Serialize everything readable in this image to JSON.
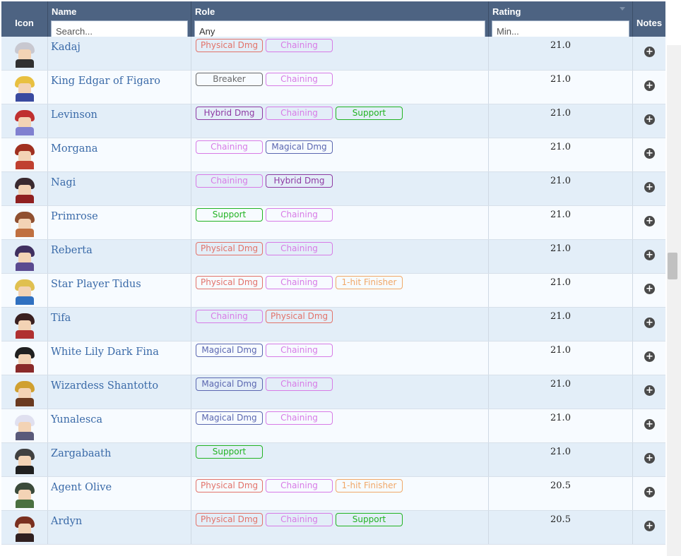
{
  "header": {
    "icon_label": "Icon",
    "name_label": "Name",
    "name_placeholder": "Search...",
    "role_label": "Role",
    "role_value": "Any",
    "rating_label": "Rating",
    "rating_placeholder": "Min...",
    "notes_label": "Notes"
  },
  "tag_colors": {
    "Physical Dmg": "#e2736a",
    "Chaining": "#d77be6",
    "Breaker": "#6a6a6a",
    "Hybrid Dmg": "#8e3aa3",
    "Support": "#22b322",
    "Magical Dmg": "#5b67b0",
    "1-hit Finisher": "#f0a868"
  },
  "rows": [
    {
      "name": "Kadaj",
      "roles": [
        "Physical Dmg",
        "Chaining"
      ],
      "rating": "21.0",
      "icon": "silver-haired-character-icon",
      "hair": "#c8c8d0",
      "outfit": "#303030"
    },
    {
      "name": "King Edgar of Figaro",
      "roles": [
        "Breaker",
        "Chaining"
      ],
      "rating": "21.0",
      "icon": "blond-king-character-icon",
      "hair": "#e8c040",
      "outfit": "#3a4aa0"
    },
    {
      "name": "Levinson",
      "roles": [
        "Hybrid Dmg",
        "Chaining",
        "Support"
      ],
      "rating": "21.0",
      "icon": "red-hat-character-icon",
      "hair": "#c03030",
      "outfit": "#8080d0"
    },
    {
      "name": "Morgana",
      "roles": [
        "Chaining",
        "Magical Dmg"
      ],
      "rating": "21.0",
      "icon": "horned-character-icon",
      "hair": "#a03020",
      "outfit": "#c04030"
    },
    {
      "name": "Nagi",
      "roles": [
        "Chaining",
        "Hybrid Dmg"
      ],
      "rating": "21.0",
      "icon": "dark-cloak-character-icon",
      "hair": "#3a2a30",
      "outfit": "#902020"
    },
    {
      "name": "Primrose",
      "roles": [
        "Support",
        "Chaining"
      ],
      "rating": "21.0",
      "icon": "dancer-character-icon",
      "hair": "#905030",
      "outfit": "#c07040"
    },
    {
      "name": "Reberta",
      "roles": [
        "Physical Dmg",
        "Chaining"
      ],
      "rating": "21.0",
      "icon": "purple-armor-character-icon",
      "hair": "#403060",
      "outfit": "#5a4a90"
    },
    {
      "name": "Star Player Tidus",
      "roles": [
        "Physical Dmg",
        "Chaining",
        "1-hit Finisher"
      ],
      "rating": "21.0",
      "icon": "blond-athlete-character-icon",
      "hair": "#e0c050",
      "outfit": "#3070c0"
    },
    {
      "name": "Tifa",
      "roles": [
        "Chaining",
        "Physical Dmg"
      ],
      "rating": "21.0",
      "icon": "dark-haired-fighter-icon",
      "hair": "#3a2020",
      "outfit": "#b03030"
    },
    {
      "name": "White Lily Dark Fina",
      "roles": [
        "Magical Dmg",
        "Chaining"
      ],
      "rating": "21.0",
      "icon": "dark-fina-character-icon",
      "hair": "#202020",
      "outfit": "#8a2a2a"
    },
    {
      "name": "Wizardess Shantotto",
      "roles": [
        "Magical Dmg",
        "Chaining"
      ],
      "rating": "21.0",
      "icon": "tarutaru-mage-icon",
      "hair": "#d0a030",
      "outfit": "#6a3a20"
    },
    {
      "name": "Yunalesca",
      "roles": [
        "Magical Dmg",
        "Chaining"
      ],
      "rating": "21.0",
      "icon": "white-haired-summoner-icon",
      "hair": "#e0e0f0",
      "outfit": "#5a5a7a"
    },
    {
      "name": "Zargabaath",
      "roles": [
        "Support"
      ],
      "rating": "21.0",
      "icon": "armored-judge-icon",
      "hair": "#404040",
      "outfit": "#202020"
    },
    {
      "name": "Agent Olive",
      "roles": [
        "Physical Dmg",
        "Chaining",
        "1-hit Finisher"
      ],
      "rating": "20.5",
      "icon": "goggled-gunner-icon",
      "hair": "#3a4a3a",
      "outfit": "#4a7040"
    },
    {
      "name": "Ardyn",
      "roles": [
        "Physical Dmg",
        "Chaining",
        "Support"
      ],
      "rating": "20.5",
      "icon": "red-haired-chancellor-icon",
      "hair": "#7a3020",
      "outfit": "#302020"
    }
  ]
}
